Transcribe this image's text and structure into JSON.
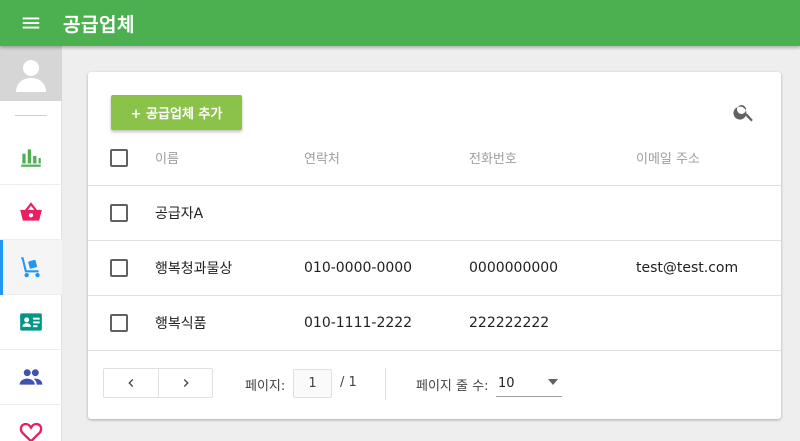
{
  "app": {
    "title": "공급업체"
  },
  "icons": {
    "menu": "menu-icon",
    "avatar": "user-avatar-icon",
    "search": "search-icon"
  },
  "colors": {
    "appbar": "#4caf50",
    "add_button": "#8bc34a",
    "active_indicator": "#2196f3",
    "chart_icon": "#4caf50",
    "basket_icon": "#e91e63",
    "truck_icon": "#2196f3",
    "card_icon": "#009688",
    "people_icon": "#3f51b5",
    "heart_icon": "#e91e63"
  },
  "sidebar": {
    "items": [
      {
        "icon": "bar-chart-icon",
        "active": false
      },
      {
        "icon": "shopping-basket-icon",
        "active": false
      },
      {
        "icon": "hand-truck-icon",
        "active": true
      },
      {
        "icon": "contact-card-icon",
        "active": false
      },
      {
        "icon": "people-icon",
        "active": false
      },
      {
        "icon": "heart-icon",
        "active": false
      }
    ]
  },
  "toolbar": {
    "add_label": "+ 공급업체 추가"
  },
  "table": {
    "headers": {
      "name": "이름",
      "contact": "연락처",
      "phone": "전화번호",
      "email": "이메일 주소"
    },
    "rows": [
      {
        "name": "공급자A",
        "contact": "",
        "phone": "",
        "email": ""
      },
      {
        "name": "행복청과물상",
        "contact": "010-0000-0000",
        "phone": "0000000000",
        "email": "test@test.com"
      },
      {
        "name": "행복식품",
        "contact": "010-1111-2222",
        "phone": "222222222",
        "email": ""
      }
    ]
  },
  "pagination": {
    "page_label": "페이지:",
    "current_page": "1",
    "total": "/ 1",
    "rows_label": "페이지 줄 수:",
    "rows_per_page": "10"
  }
}
